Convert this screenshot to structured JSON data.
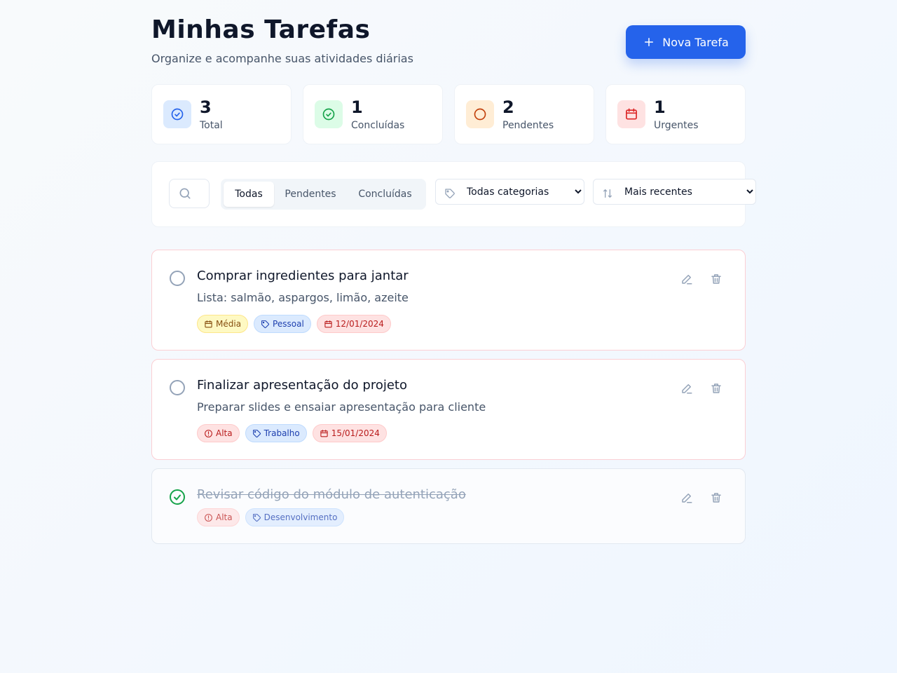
{
  "header": {
    "title": "Minhas Tarefas",
    "subtitle": "Organize e acompanhe suas atividades diárias",
    "new_task_label": "Nova Tarefa"
  },
  "stats": [
    {
      "value": "3",
      "label": "Total",
      "icon": "check-circle-icon",
      "color": "#2563eb",
      "bg": "#dbeafe"
    },
    {
      "value": "1",
      "label": "Concluídas",
      "icon": "check-circle-icon",
      "color": "#16a34a",
      "bg": "#dcfce7"
    },
    {
      "value": "2",
      "label": "Pendentes",
      "icon": "circle-icon",
      "color": "#c2410c",
      "bg": "#ffedd5"
    },
    {
      "value": "1",
      "label": "Urgentes",
      "icon": "calendar-icon",
      "color": "#dc2626",
      "bg": "#fee2e2"
    }
  ],
  "filters": {
    "search_value": "",
    "status_tabs": [
      "Todas",
      "Pendentes",
      "Concluídas"
    ],
    "active_tab": "Todas",
    "category_selected": "Todas categorias",
    "sort_selected": "Mais recentes"
  },
  "tasks": [
    {
      "title": "Comprar ingredientes para jantar",
      "description": "Lista: salmão, aspargos, limão, azeite",
      "completed": false,
      "priority": "Média",
      "category": "Pessoal",
      "due_date": "12/01/2024"
    },
    {
      "title": "Finalizar apresentação do projeto",
      "description": "Preparar slides e ensaiar apresentação para cliente",
      "completed": false,
      "priority": "Alta",
      "category": "Trabalho",
      "due_date": "15/01/2024"
    },
    {
      "title": "Revisar código do módulo de autenticação",
      "description": "",
      "completed": true,
      "priority": "Alta",
      "category": "Desenvolvimento",
      "due_date": ""
    }
  ],
  "colors": {
    "primary": "#2563eb",
    "success": "#16a34a",
    "danger": "#dc2626",
    "warning": "#ca8a04"
  }
}
